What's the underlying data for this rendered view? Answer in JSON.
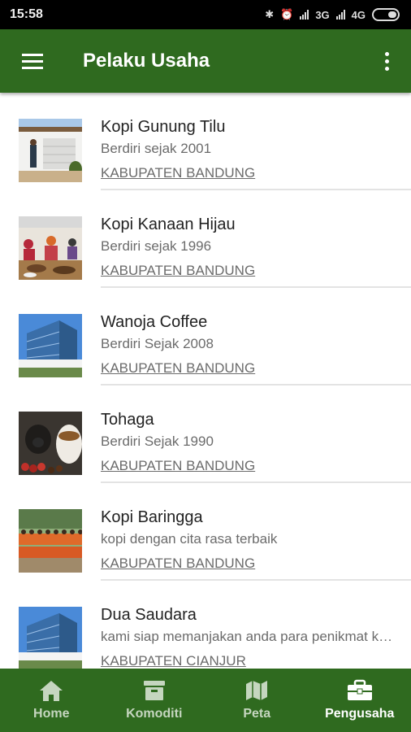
{
  "status": {
    "time": "15:58",
    "net1": "3G",
    "net2": "4G"
  },
  "appbar": {
    "title": "Pelaku Usaha"
  },
  "items": [
    {
      "name": "Kopi Gunung Tilu",
      "since": "Berdiri sejak 2001",
      "region": "KABUPATEN BANDUNG"
    },
    {
      "name": "Kopi Kanaan Hijau",
      "since": "Berdiri sejak 1996",
      "region": "KABUPATEN BANDUNG"
    },
    {
      "name": "Wanoja Coffee",
      "since": "Berdiri Sejak 2008",
      "region": "KABUPATEN BANDUNG"
    },
    {
      "name": "Tohaga",
      "since": "Berdiri Sejak 1990",
      "region": "KABUPATEN BANDUNG"
    },
    {
      "name": "Kopi Baringga",
      "since": "kopi dengan cita rasa terbaik",
      "region": "KABUPATEN BANDUNG"
    },
    {
      "name": "Dua Saudara",
      "since": "kami siap memanjakan anda para penikmat kopi",
      "region": "KABUPATEN CIANJUR"
    }
  ],
  "nav": [
    {
      "label": "Home",
      "icon": "home-icon"
    },
    {
      "label": "Komoditi",
      "icon": "box-icon"
    },
    {
      "label": "Peta",
      "icon": "map-icon"
    },
    {
      "label": "Pengusaha",
      "icon": "briefcase-icon"
    }
  ],
  "colors": {
    "primary": "#2f6a1f",
    "active_nav": "#ffffff",
    "inactive_nav": "#c5d6bf"
  }
}
